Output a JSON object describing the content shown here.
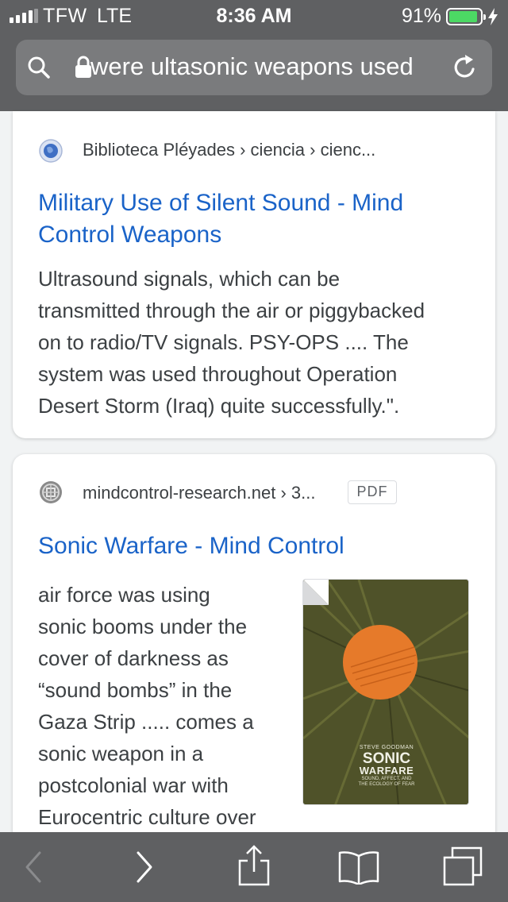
{
  "status_bar": {
    "carrier": "TFW",
    "network": "LTE",
    "time": "8:36 AM",
    "battery_percent": "91%",
    "battery_level": 0.91,
    "battery_color": "#4cd964",
    "signal_icon": "signal-bars-icon",
    "charging_icon": "charging-bolt-icon"
  },
  "url_bar": {
    "text": "were ultasonic weapons used",
    "search_icon": "search-icon",
    "lock_icon": "lock-icon",
    "reload_icon": "reload-icon"
  },
  "results": [
    {
      "favicon": "globe-icon",
      "source": "Biblioteca Pléyades › ciencia › cienc...",
      "title_lines": [
        "Military Use of Silent Sound - Mind",
        "Control Weapons"
      ],
      "snippet_lines": [
        "Ultrasound signals, which can be",
        "transmitted through the air or piggybacked",
        "on to radio/TV signals. PSY-OPS .... The",
        "system was used throughout Operation",
        "Desert Storm (Iraq) quite successfully.\"."
      ]
    },
    {
      "favicon": "site-logo-icon",
      "source": "mindcontrol-research.net › 3...",
      "badge": "PDF",
      "title_lines": [
        "Sonic Warfare - Mind Control"
      ],
      "snippet_lines": [
        "air force was using",
        "sonic booms under the",
        "cover of darkness as",
        "“sound bombs” in the",
        "Gaza Strip ..... comes a",
        "sonic weapon in a",
        "postcolonial war with",
        "Eurocentric culture over"
      ],
      "thumbnail": {
        "author": "STEVE GOODMAN",
        "title_line1": "SONIC",
        "title_line2": "WARFARE",
        "subtitle_line1": "SOUND, AFFECT, AND",
        "subtitle_line2": "THE ECOLOGY OF FEAR"
      }
    }
  ],
  "toolbar": {
    "back_icon": "back-chevron-icon",
    "forward_icon": "forward-chevron-icon",
    "share_icon": "share-icon",
    "bookmarks_icon": "bookmarks-book-icon",
    "tabs_icon": "tabs-icon"
  },
  "colors": {
    "chrome": "#5f6062",
    "url_field": "#7a7b7d",
    "link": "#1a63c8",
    "page_bg": "#f1f3f4"
  }
}
